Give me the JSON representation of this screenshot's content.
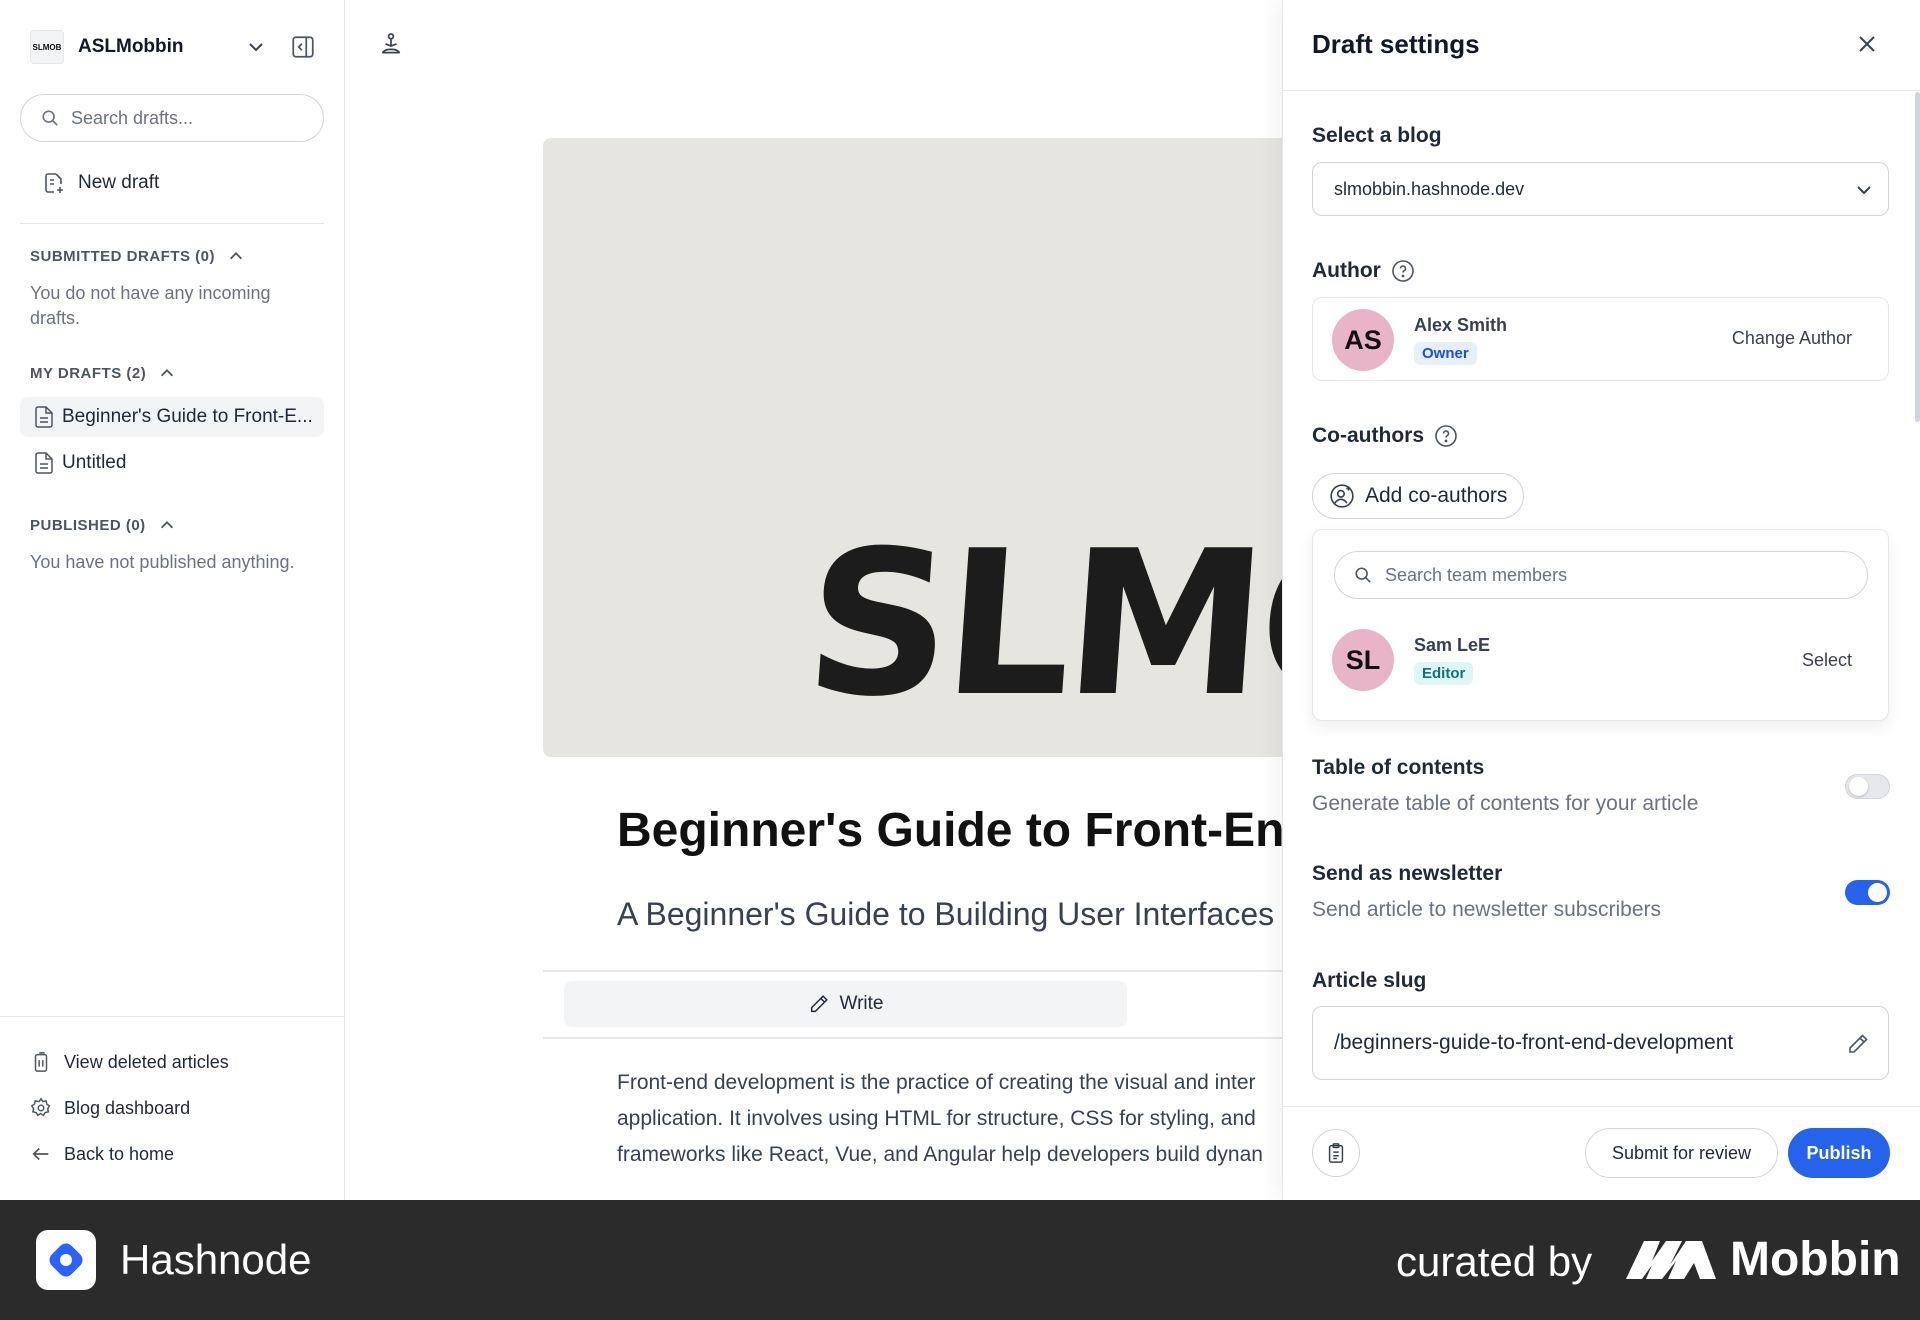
{
  "sidebar": {
    "workspace_logo_text": "SLMOB",
    "workspace_name": "ASLMobbin",
    "search_placeholder": "Search drafts...",
    "new_draft_label": "New draft",
    "submitted_heading": "SUBMITTED DRAFTS (0)",
    "submitted_empty": "You do not have any incoming drafts.",
    "my_drafts_heading": "MY DRAFTS (2)",
    "my_drafts": [
      {
        "label": "Beginner's Guide to Front-E...",
        "active": true
      },
      {
        "label": "Untitled",
        "active": false
      }
    ],
    "published_heading": "PUBLISHED (0)",
    "published_empty": "You have not published anything.",
    "bottom_links": {
      "deleted": "View deleted articles",
      "dashboard": "Blog dashboard",
      "back_home": "Back to home"
    }
  },
  "editor": {
    "cover_text": "SLMO",
    "title": "Beginner's Guide to Front-End",
    "subtitle": "A Beginner's Guide to Building User Interfaces",
    "write_tab_label": "Write",
    "body_lines": [
      "Front-end development is the practice of creating the visual and inter",
      "application. It involves using HTML for structure, CSS for styling, and",
      "frameworks like React, Vue, and Angular help developers build dynan"
    ]
  },
  "panel": {
    "title": "Draft settings",
    "select_blog_label": "Select a blog",
    "selected_blog": "slmobbin.hashnode.dev",
    "author_label": "Author",
    "author": {
      "initials": "AS",
      "name": "Alex Smith",
      "role": "Owner",
      "action": "Change Author"
    },
    "coauthors_label": "Co-authors",
    "add_coauthors_label": "Add co-authors",
    "team_search_placeholder": "Search team members",
    "team_members": [
      {
        "initials": "SL",
        "name": "Sam LeE",
        "role": "Editor",
        "action": "Select"
      }
    ],
    "toc": {
      "title": "Table of contents",
      "desc": "Generate table of contents for your article",
      "enabled": false
    },
    "newsletter": {
      "title": "Send as newsletter",
      "desc": "Send article to newsletter subscribers",
      "enabled": true
    },
    "slug_label": "Article slug",
    "slug_value": "/beginners-guide-to-front-end-development",
    "submit_review_label": "Submit for review",
    "publish_label": "Publish"
  },
  "banner": {
    "app_name": "Hashnode",
    "curated_by": "curated by",
    "mobbin": "Mobbin"
  },
  "colors": {
    "accent": "#2563eb",
    "avatar_bg": "#e8b4c8",
    "banner_bg": "#2b2b2b",
    "cover_bg": "#e6e5df"
  }
}
